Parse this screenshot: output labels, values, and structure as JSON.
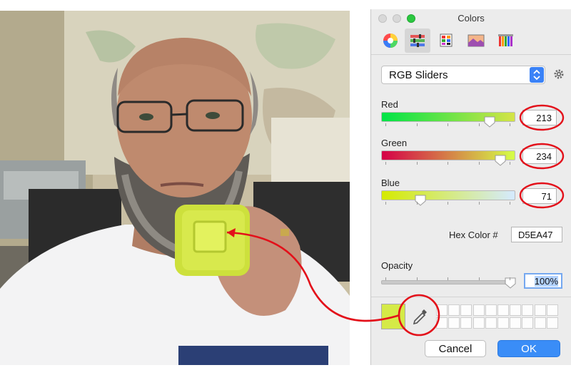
{
  "panel": {
    "title": "Colors",
    "tabs": [
      "color-wheel",
      "color-sliders",
      "color-palettes",
      "image-palettes",
      "pencils"
    ],
    "mode": "RGB Sliders",
    "sliders": [
      {
        "label": "Red",
        "value": "213",
        "fraction": 0.835
      },
      {
        "label": "Green",
        "value": "234",
        "fraction": 0.918
      },
      {
        "label": "Blue",
        "value": "71",
        "fraction": 0.278
      }
    ],
    "hex_label": "Hex Color #",
    "hex_value": "D5EA47",
    "opacity_label": "Opacity",
    "opacity_value": "100%",
    "opacity_fraction": 1.0,
    "current_color": "#d5ea47",
    "cancel_label": "Cancel",
    "ok_label": "OK"
  },
  "annotation_color": "#e3101a",
  "accent": "#3a8df7"
}
